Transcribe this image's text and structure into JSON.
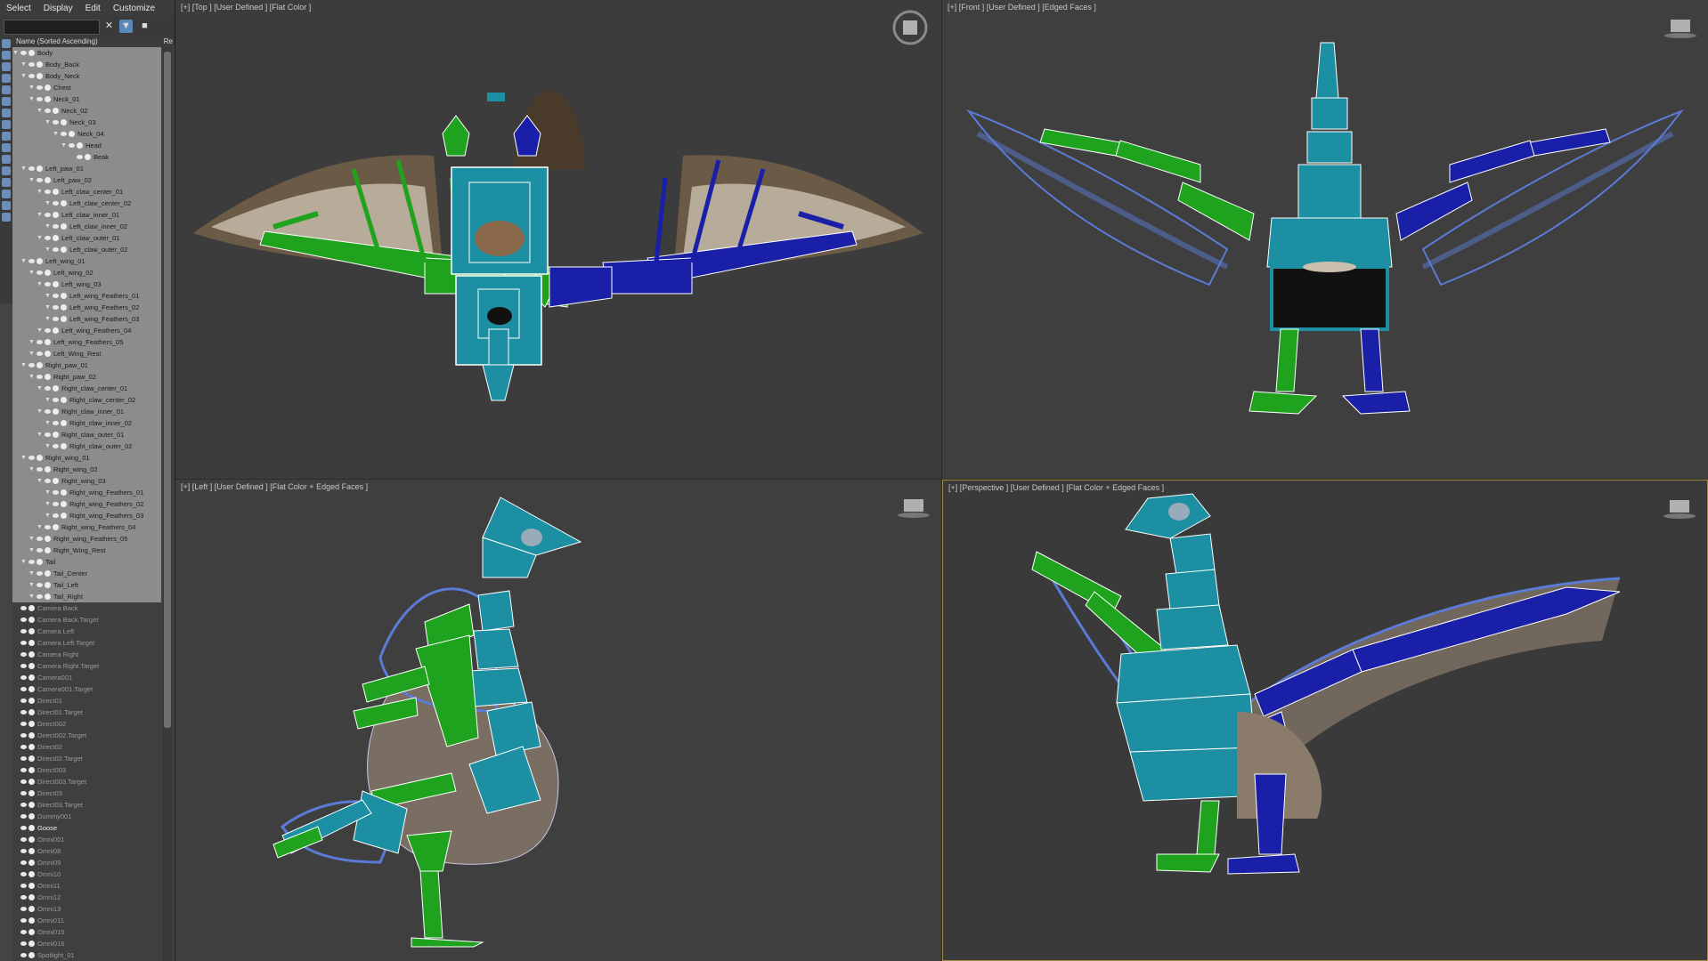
{
  "menu": [
    "Select",
    "Display",
    "Edit",
    "Customize"
  ],
  "explorer": {
    "column_header": "Name (Sorted Ascending)",
    "column_right": "Re",
    "rows": [
      {
        "label": "Body",
        "depth": 0,
        "sel": true
      },
      {
        "label": "Body_Back",
        "depth": 1,
        "sel": true
      },
      {
        "label": "Body_Neck",
        "depth": 1,
        "sel": true
      },
      {
        "label": "Chest",
        "depth": 2,
        "sel": true
      },
      {
        "label": "Neck_01",
        "depth": 2,
        "sel": true
      },
      {
        "label": "Neck_02",
        "depth": 3,
        "sel": true
      },
      {
        "label": "Neck_03",
        "depth": 4,
        "sel": true
      },
      {
        "label": "Neck_04",
        "depth": 5,
        "sel": true
      },
      {
        "label": "Head",
        "depth": 6,
        "sel": true
      },
      {
        "label": "Beak",
        "depth": 7,
        "sel": true
      },
      {
        "label": "Left_paw_01",
        "depth": 1,
        "sel": true
      },
      {
        "label": "Left_paw_02",
        "depth": 2,
        "sel": true
      },
      {
        "label": "Left_claw_center_01",
        "depth": 3,
        "sel": true
      },
      {
        "label": "Left_claw_center_02",
        "depth": 4,
        "sel": true
      },
      {
        "label": "Left_claw_inner_01",
        "depth": 3,
        "sel": true
      },
      {
        "label": "Left_claw_inner_02",
        "depth": 4,
        "sel": true
      },
      {
        "label": "Left_claw_outer_01",
        "depth": 3,
        "sel": true
      },
      {
        "label": "Left_claw_outer_02",
        "depth": 4,
        "sel": true
      },
      {
        "label": "Left_wing_01",
        "depth": 1,
        "sel": true
      },
      {
        "label": "Left_wing_02",
        "depth": 2,
        "sel": true
      },
      {
        "label": "Left_wing_03",
        "depth": 3,
        "sel": true
      },
      {
        "label": "Left_wing_Feathers_01",
        "depth": 4,
        "sel": true
      },
      {
        "label": "Left_wing_Feathers_02",
        "depth": 4,
        "sel": true
      },
      {
        "label": "Left_wing_Feathers_03",
        "depth": 4,
        "sel": true
      },
      {
        "label": "Left_wing_Feathers_04",
        "depth": 3,
        "sel": true
      },
      {
        "label": "Left_wing_Feathers_05",
        "depth": 2,
        "sel": true
      },
      {
        "label": "Left_Wing_Rest",
        "depth": 2,
        "sel": true
      },
      {
        "label": "Right_paw_01",
        "depth": 1,
        "sel": true
      },
      {
        "label": "Right_paw_02",
        "depth": 2,
        "sel": true
      },
      {
        "label": "Right_claw_center_01",
        "depth": 3,
        "sel": true
      },
      {
        "label": "Right_claw_center_02",
        "depth": 4,
        "sel": true
      },
      {
        "label": "Right_claw_inner_01",
        "depth": 3,
        "sel": true
      },
      {
        "label": "Right_claw_inner_02",
        "depth": 4,
        "sel": true
      },
      {
        "label": "Right_claw_outer_01",
        "depth": 3,
        "sel": true
      },
      {
        "label": "Right_claw_outer_02",
        "depth": 4,
        "sel": true
      },
      {
        "label": "Right_wing_01",
        "depth": 1,
        "sel": true
      },
      {
        "label": "Right_wing_02",
        "depth": 2,
        "sel": true
      },
      {
        "label": "Right_wing_03",
        "depth": 3,
        "sel": true
      },
      {
        "label": "Right_wing_Feathers_01",
        "depth": 4,
        "sel": true
      },
      {
        "label": "Right_wing_Feathers_02",
        "depth": 4,
        "sel": true
      },
      {
        "label": "Right_wing_Feathers_03",
        "depth": 4,
        "sel": true
      },
      {
        "label": "Right_wing_Feathers_04",
        "depth": 3,
        "sel": true
      },
      {
        "label": "Right_wing_Feathers_05",
        "depth": 2,
        "sel": true
      },
      {
        "label": "Right_Wing_Rest",
        "depth": 2,
        "sel": true
      },
      {
        "label": "Tail",
        "depth": 1,
        "sel": true
      },
      {
        "label": "Tail_Center",
        "depth": 2,
        "sel": true
      },
      {
        "label": "Tail_Left",
        "depth": 2,
        "sel": true
      },
      {
        "label": "Tail_Right",
        "depth": 2,
        "sel": true
      },
      {
        "label": "Camera Back",
        "depth": 0,
        "sel": false
      },
      {
        "label": "Camera Back.Target",
        "depth": 0,
        "sel": false
      },
      {
        "label": "Camera Left",
        "depth": 0,
        "sel": false
      },
      {
        "label": "Camera Left.Target",
        "depth": 0,
        "sel": false
      },
      {
        "label": "Camera Right",
        "depth": 0,
        "sel": false
      },
      {
        "label": "Camera Right.Target",
        "depth": 0,
        "sel": false
      },
      {
        "label": "Camera001",
        "depth": 0,
        "sel": false
      },
      {
        "label": "Camera001.Target",
        "depth": 0,
        "sel": false
      },
      {
        "label": "Direct01",
        "depth": 0,
        "sel": false
      },
      {
        "label": "Direct01.Target",
        "depth": 0,
        "sel": false
      },
      {
        "label": "Direct002",
        "depth": 0,
        "sel": false
      },
      {
        "label": "Direct002.Target",
        "depth": 0,
        "sel": false
      },
      {
        "label": "Direct02",
        "depth": 0,
        "sel": false
      },
      {
        "label": "Direct02.Target",
        "depth": 0,
        "sel": false
      },
      {
        "label": "Direct003",
        "depth": 0,
        "sel": false
      },
      {
        "label": "Direct003.Target",
        "depth": 0,
        "sel": false
      },
      {
        "label": "Direct03",
        "depth": 0,
        "sel": false
      },
      {
        "label": "Direct03.Target",
        "depth": 0,
        "sel": false
      },
      {
        "label": "Dummy001",
        "depth": 0,
        "sel": false
      },
      {
        "label": "Goose",
        "depth": 0,
        "sel": false,
        "bright": true
      },
      {
        "label": "Omni001",
        "depth": 0,
        "sel": false
      },
      {
        "label": "Omni08",
        "depth": 0,
        "sel": false
      },
      {
        "label": "Omni09",
        "depth": 0,
        "sel": false
      },
      {
        "label": "Omni10",
        "depth": 0,
        "sel": false
      },
      {
        "label": "Omni11",
        "depth": 0,
        "sel": false
      },
      {
        "label": "Omni12",
        "depth": 0,
        "sel": false
      },
      {
        "label": "Omni13",
        "depth": 0,
        "sel": false
      },
      {
        "label": "Omni011",
        "depth": 0,
        "sel": false
      },
      {
        "label": "Omni015",
        "depth": 0,
        "sel": false
      },
      {
        "label": "Omni016",
        "depth": 0,
        "sel": false
      },
      {
        "label": "Spotlight_01",
        "depth": 0,
        "sel": false
      }
    ]
  },
  "viewports": {
    "top": "[+] [Top ] [User Defined ] [Flat Color ]",
    "front": "[+] [Front ] [User Defined ] [Edged Faces ]",
    "left": "[+] [Left ] [User Defined ] [Flat Color + Edged Faces ]",
    "persp": "[+] [Perspective ] [User Defined ] [Flat Color + Edged Faces ]"
  },
  "colors": {
    "bone_teal": "#1c8fa3",
    "bone_green": "#1fa31f",
    "bone_blue": "#1a1fa8",
    "selection_border": "#a08a46"
  }
}
